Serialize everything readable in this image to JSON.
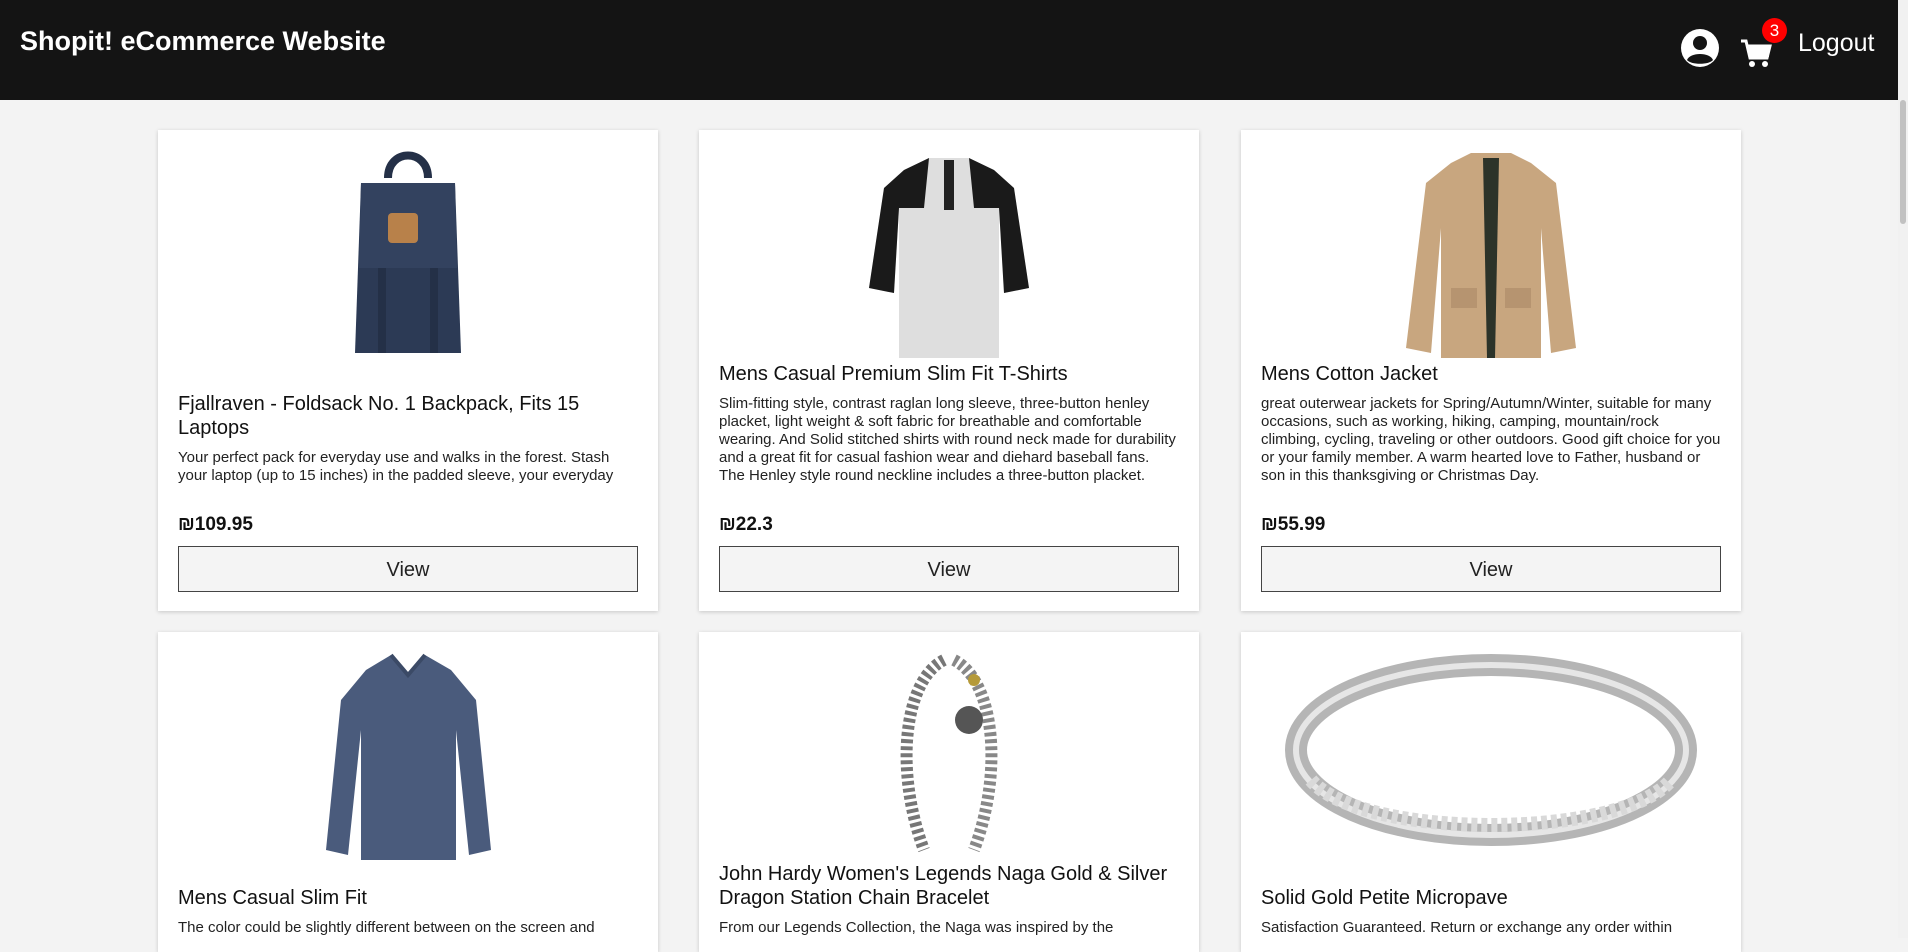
{
  "header": {
    "brand": "Shopit! eCommerce Website",
    "cart_count": "3",
    "logout_label": "Logout",
    "user_icon": "user-circle-icon",
    "cart_icon": "shopping-cart-icon"
  },
  "products": [
    {
      "title": "Fjallraven - Foldsack No. 1 Backpack, Fits 15 Laptops",
      "description": "Your perfect pack for everyday use and walks in the forest. Stash your laptop (up to 15 inches) in the padded sleeve, your everyday",
      "price": "₪109.95",
      "button": "View",
      "image": "backpack"
    },
    {
      "title": "Mens Casual Premium Slim Fit T-Shirts",
      "description": "Slim-fitting style, contrast raglan long sleeve, three-button henley placket, light weight & soft fabric for breathable and comfortable wearing. And Solid stitched shirts with round neck made for durability and a great fit for casual fashion wear and diehard baseball fans. The Henley style round neckline includes a three-button placket.",
      "price": "₪22.3",
      "button": "View",
      "image": "raglan-tshirt"
    },
    {
      "title": "Mens Cotton Jacket",
      "description": "great outerwear jackets for Spring/Autumn/Winter, suitable for many occasions, such as working, hiking, camping, mountain/rock climbing, cycling, traveling or other outdoors. Good gift choice for you or your family member. A warm hearted love to Father, husband or son in this thanksgiving or Christmas Day.",
      "price": "₪55.99",
      "button": "View",
      "image": "cotton-jacket"
    },
    {
      "title": "Mens Casual Slim Fit",
      "description": "The color could be slightly different between on the screen and",
      "image": "long-sleeve-shirt"
    },
    {
      "title": "John Hardy Women's Legends Naga Gold & Silver Dragon Station Chain Bracelet",
      "description": "From our Legends Collection, the Naga was inspired by the",
      "image": "dragon-bracelet"
    },
    {
      "title": "Solid Gold Petite Micropave",
      "description": "Satisfaction Guaranteed. Return or exchange any order within",
      "image": "diamond-ring"
    }
  ]
}
